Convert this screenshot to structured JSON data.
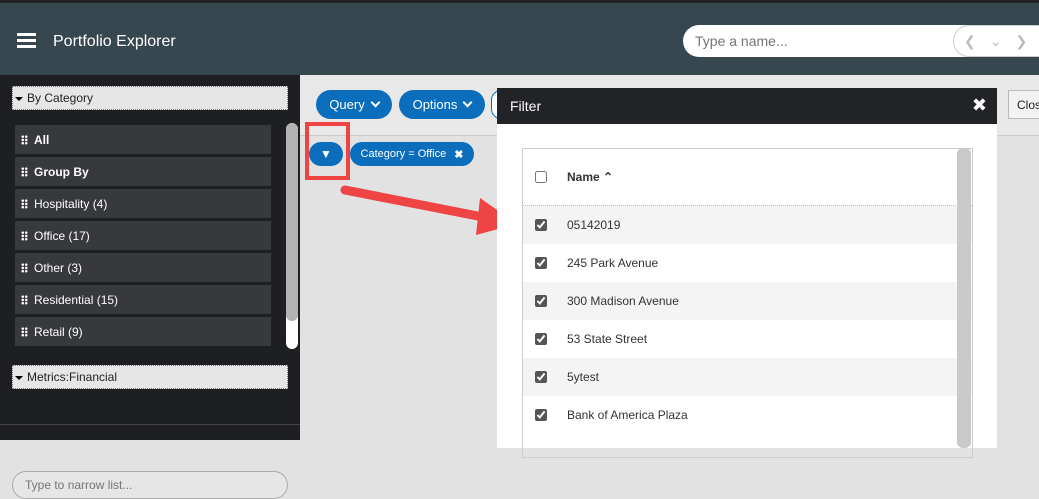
{
  "header": {
    "title": "Portfolio Explorer",
    "search_placeholder": "Type a name..."
  },
  "sidebar": {
    "category_section": "By Category",
    "items": [
      {
        "label": "All",
        "bold": true
      },
      {
        "label": "Group By",
        "bold": true
      },
      {
        "label": "Hospitality (4)"
      },
      {
        "label": "Office (17)"
      },
      {
        "label": "Other (3)"
      },
      {
        "label": "Residential (15)"
      },
      {
        "label": "Retail (9)"
      }
    ],
    "metrics_section": "Metrics:Financial",
    "narrow_placeholder": "Type to narrow list..."
  },
  "toolbar": {
    "query": "Query",
    "options": "Options",
    "close": "Clos",
    "filter_chip": "Category = Office"
  },
  "filter_modal": {
    "title": "Filter",
    "column": "Name",
    "rows": [
      {
        "name": "05142019",
        "checked": true
      },
      {
        "name": "245 Park Avenue",
        "checked": true
      },
      {
        "name": "300 Madison Avenue",
        "checked": true
      },
      {
        "name": "53 State Street",
        "checked": true
      },
      {
        "name": "5ytest",
        "checked": true
      },
      {
        "name": "Bank of America Plaza",
        "checked": true
      }
    ]
  },
  "colors": {
    "accent": "#0a6ebd",
    "header": "#37474f",
    "annotation": "#ee4444"
  }
}
